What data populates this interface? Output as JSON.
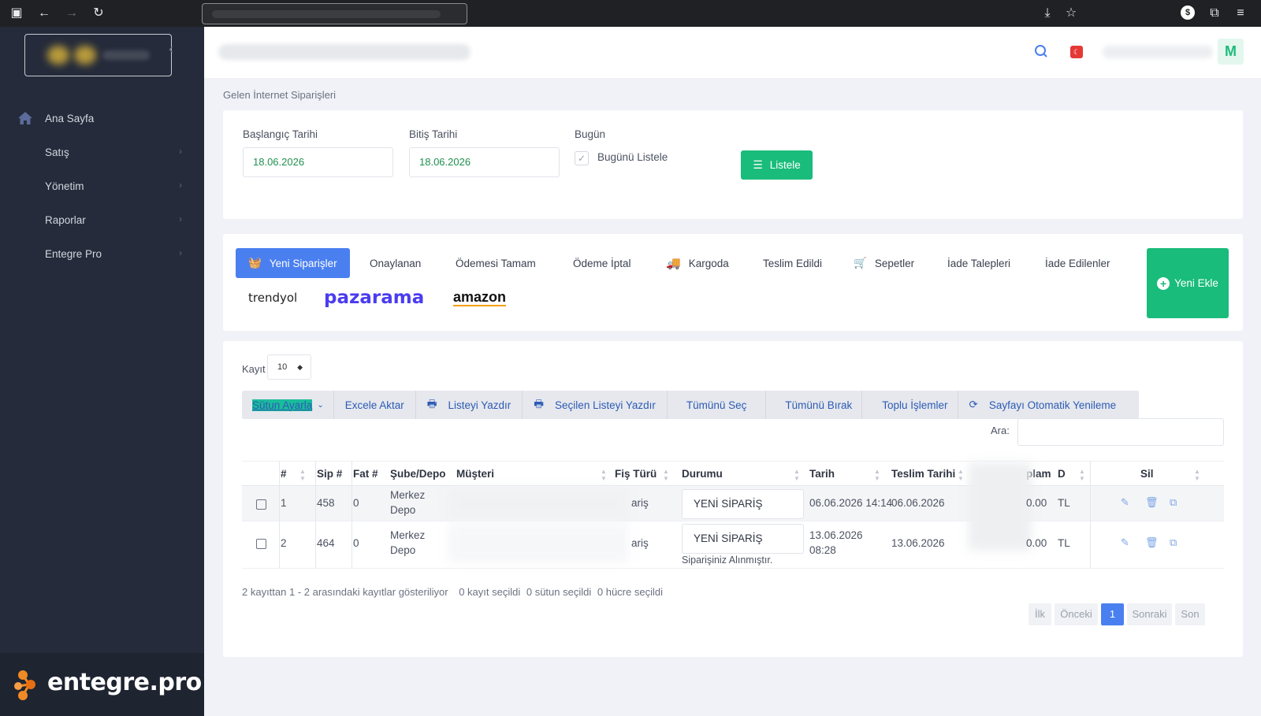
{
  "sidebar": {
    "items": [
      {
        "label": "Ana Sayfa"
      },
      {
        "label": "Satış"
      },
      {
        "label": "Yönetim"
      },
      {
        "label": "Raporlar"
      },
      {
        "label": "Entegre Pro"
      }
    ],
    "brand": "entegre.pro"
  },
  "topbar": {
    "avatar_letter": "M"
  },
  "breadcrumb": "Gelen İnternet Siparişleri",
  "filters": {
    "start_label": "Başlangıç Tarihi",
    "start_value": "18.06.2026",
    "end_label": "Bitiş Tarihi",
    "end_value": "18.06.2026",
    "today_label": "Bugün",
    "today_check_label": "Bugünü Listele",
    "list_button": "Listele"
  },
  "tabs": [
    {
      "label": "Yeni Siparişler"
    },
    {
      "label": "Onaylanan"
    },
    {
      "label": "Ödemesi Tamam"
    },
    {
      "label": "Ödeme İptal"
    },
    {
      "label": "Kargoda"
    },
    {
      "label": "Teslim Edildi"
    },
    {
      "label": "Sepetler"
    },
    {
      "label": "İade Talepleri"
    },
    {
      "label": "İade Edilenler"
    }
  ],
  "marketplaces": [
    "trendyol",
    "pazarama",
    "amazon"
  ],
  "new_button": "Yeni Ekle",
  "table": {
    "records_label": "Kayıt",
    "records_value": "10",
    "toolbar": {
      "columns": "Sütun Ayarla",
      "excel": "Excele Aktar",
      "print": "Listeyi Yazdır",
      "print_selected": "Seçilen Listeyi Yazdır",
      "select_all": "Tümünü Seç",
      "deselect_all": "Tümünü Bırak",
      "bulk": "Toplu İşlemler",
      "auto_refresh": "Sayfayı Otomatik Yenileme"
    },
    "search_label": "Ara:",
    "headers": {
      "num": "#",
      "sip": "Sip #",
      "fat": "Fat #",
      "sube": "Şube/Depo",
      "musteri": "Müşteri",
      "fis": "Fiş Türü",
      "durum": "Durumu",
      "tarih": "Tarih",
      "teslim": "Teslim Tarihi",
      "toplam": "plam",
      "d": "D",
      "sil": "Sil"
    },
    "rows": [
      {
        "num": "1",
        "sip": "458",
        "fat": "0",
        "sube1": "Merkez",
        "sube2": "Depo",
        "fis": "ariş",
        "durum": "YENİ SİPARİŞ",
        "note": "",
        "tarih1": "06.06.2026 14:14",
        "tarih2": "",
        "teslim": "06.06.2026",
        "toplam": "0.00",
        "d": "TL"
      },
      {
        "num": "2",
        "sip": "464",
        "fat": "0",
        "sube1": "Merkez",
        "sube2": "Depo",
        "fis": "ariş",
        "durum": "YENİ SİPARİŞ",
        "note": "Siparişiniz Alınmıştır.",
        "tarih1": "13.06.2026",
        "tarih2": "08:28",
        "teslim": "13.06.2026",
        "toplam": "0.00",
        "d": "TL"
      }
    ],
    "info": "2 kayıttan 1 - 2 arasındaki kayıtlar gösteriliyor",
    "sel_rows": "0 kayıt seçildi",
    "sel_cols": "0 sütun seçildi",
    "sel_cells": "0 hücre seçildi",
    "pager": {
      "first": "İlk",
      "prev": "Önceki",
      "page": "1",
      "next": "Sonraki",
      "last": "Son"
    }
  }
}
